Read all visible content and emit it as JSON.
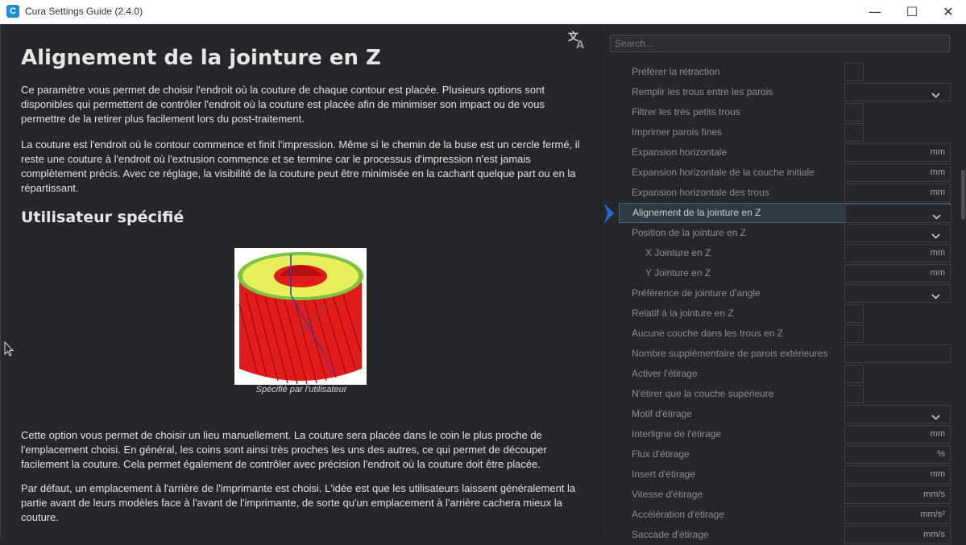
{
  "window": {
    "app_icon_letter": "C",
    "title": "Cura Settings Guide (2.4.0)",
    "minimize_glyph": "—",
    "maximize_glyph": "☐",
    "close_glyph": "✕"
  },
  "article": {
    "title": "Alignement de la jointure en Z",
    "intro_p1": "Ce paramètre vous permet de choisir l'endroit où la couture de chaque contour est placée. Plusieurs options sont disponibles qui permettent de contrôler l'endroit où la couture est placée afin de minimiser son impact ou de vous permettre de la retirer plus facilement lors du post-traitement.",
    "intro_p2": "La couture est l'endroit où le contour commence et finit l'impression. Même si le chemin de la buse est un cercle fermé, il reste une couture à l'endroit où l'extrusion commence et se termine car le processus d'impression n'est jamais complètement précis. Avec ce réglage, la visibilité de la couture peut être minimisée en la cachant quelque part ou en la répartissant.",
    "section_title": "Utilisateur spécifié",
    "figure_caption": "Spécifié par l'utilisateur",
    "section_p1": "Cette option vous permet de choisir un lieu manuellement. La couture sera placée dans le coin le plus proche de l'emplacement choisi. En général, les coins sont ainsi très proches les uns des autres, ce qui permet de découper facilement la couture. Cela permet également de contrôler avec précision l'endroit où la couture doit être placée.",
    "section_p2": "Par défaut, un emplacement à l'arrière de l'imprimante est choisi. L'idée est que les utilisateurs laissent généralement la partie avant de leurs modèles face à l'avant de l'imprimante, de sorte qu'un emplacement à l'arrière cachera mieux la couture."
  },
  "sidebar": {
    "search_placeholder": "Search...",
    "rows": [
      {
        "label": "Préférer la rétraction",
        "control": "checkbox",
        "unit": ""
      },
      {
        "label": "Remplir les trous entre les parois",
        "control": "dropdown",
        "unit": ""
      },
      {
        "label": "Filtrer les très petits trous",
        "control": "checkbox",
        "unit": ""
      },
      {
        "label": "Imprimer parois fines",
        "control": "checkbox",
        "unit": ""
      },
      {
        "label": "Expansion horizontale",
        "control": "number",
        "unit": "mm"
      },
      {
        "label": "Expansion horizontale de la couche initiale",
        "control": "number",
        "unit": "mm"
      },
      {
        "label": "Expansion horizontale des trous",
        "control": "number",
        "unit": "mm"
      },
      {
        "label": "Alignement de la jointure en Z",
        "control": "dropdown",
        "unit": "",
        "selected": true
      },
      {
        "label": "Position de la jointure en Z",
        "control": "dropdown",
        "unit": ""
      },
      {
        "label": "X Jointure en Z",
        "control": "number",
        "unit": "mm",
        "indent": true
      },
      {
        "label": "Y Jointure en Z",
        "control": "number",
        "unit": "mm",
        "indent": true
      },
      {
        "label": "Préférence de jointure d'angle",
        "control": "dropdown",
        "unit": ""
      },
      {
        "label": "Relatif à la jointure en Z",
        "control": "checkbox",
        "unit": ""
      },
      {
        "label": "Aucune couche dans les trous en Z",
        "control": "checkbox",
        "unit": ""
      },
      {
        "label": "Nombre supplémentaire de parois extérieures",
        "control": "number",
        "unit": ""
      },
      {
        "label": "Activer l'étirage",
        "control": "checkbox",
        "unit": ""
      },
      {
        "label": "N'étirer que la couche supérieure",
        "control": "checkbox",
        "unit": ""
      },
      {
        "label": "Motif d'étirage",
        "control": "dropdown",
        "unit": ""
      },
      {
        "label": "Interligne de l'étirage",
        "control": "number",
        "unit": "mm"
      },
      {
        "label": "Flux d'étirage",
        "control": "number",
        "unit": "%"
      },
      {
        "label": "Insert d'étirage",
        "control": "number",
        "unit": "mm"
      },
      {
        "label": "Vitesse d'étirage",
        "control": "number",
        "unit": "mm/s"
      },
      {
        "label": "Accélération d'étirage",
        "control": "number",
        "unit": "mm/s²"
      },
      {
        "label": "Saccade d'étirage",
        "control": "number",
        "unit": "mm/s"
      }
    ]
  },
  "colors": {
    "accent": "#1c6cd6",
    "selected_row_bg": "#2f3b42",
    "panel_bg": "#25272b"
  }
}
